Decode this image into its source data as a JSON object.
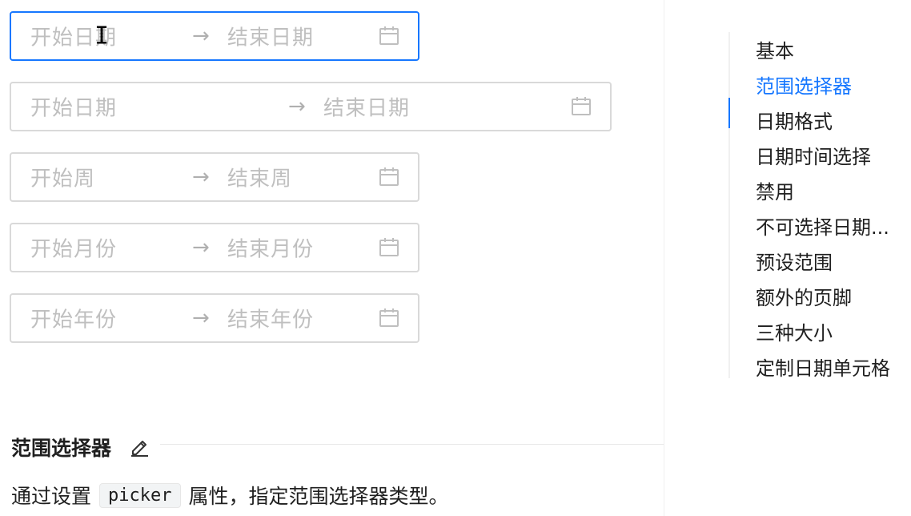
{
  "pickers": [
    {
      "start_placeholder": "开始日期",
      "end_placeholder": "结束日期",
      "focused": true
    },
    {
      "start_placeholder": "开始日期",
      "end_placeholder": "结束日期",
      "focused": false
    },
    {
      "start_placeholder": "开始周",
      "end_placeholder": "结束周",
      "focused": false
    },
    {
      "start_placeholder": "开始月份",
      "end_placeholder": "结束月份",
      "focused": false
    },
    {
      "start_placeholder": "开始年份",
      "end_placeholder": "结束年份",
      "focused": false
    }
  ],
  "separator": "→",
  "section": {
    "title": "范围选择器",
    "desc_before": "通过设置",
    "code": "picker",
    "desc_after": "属性，指定范围选择器类型。"
  },
  "anchor": {
    "items": [
      {
        "label": "基本"
      },
      {
        "label": "范围选择器"
      },
      {
        "label": "日期格式"
      },
      {
        "label": "日期时间选择"
      },
      {
        "label": "禁用"
      },
      {
        "label": "不可选择日期..."
      },
      {
        "label": "预设范围"
      },
      {
        "label": "额外的页脚"
      },
      {
        "label": "三种大小"
      },
      {
        "label": "定制日期单元格"
      }
    ],
    "active_index": 1
  },
  "colors": {
    "accent": "#1677ff",
    "placeholder": "#bfbfbf",
    "border": "#d9d9d9"
  }
}
